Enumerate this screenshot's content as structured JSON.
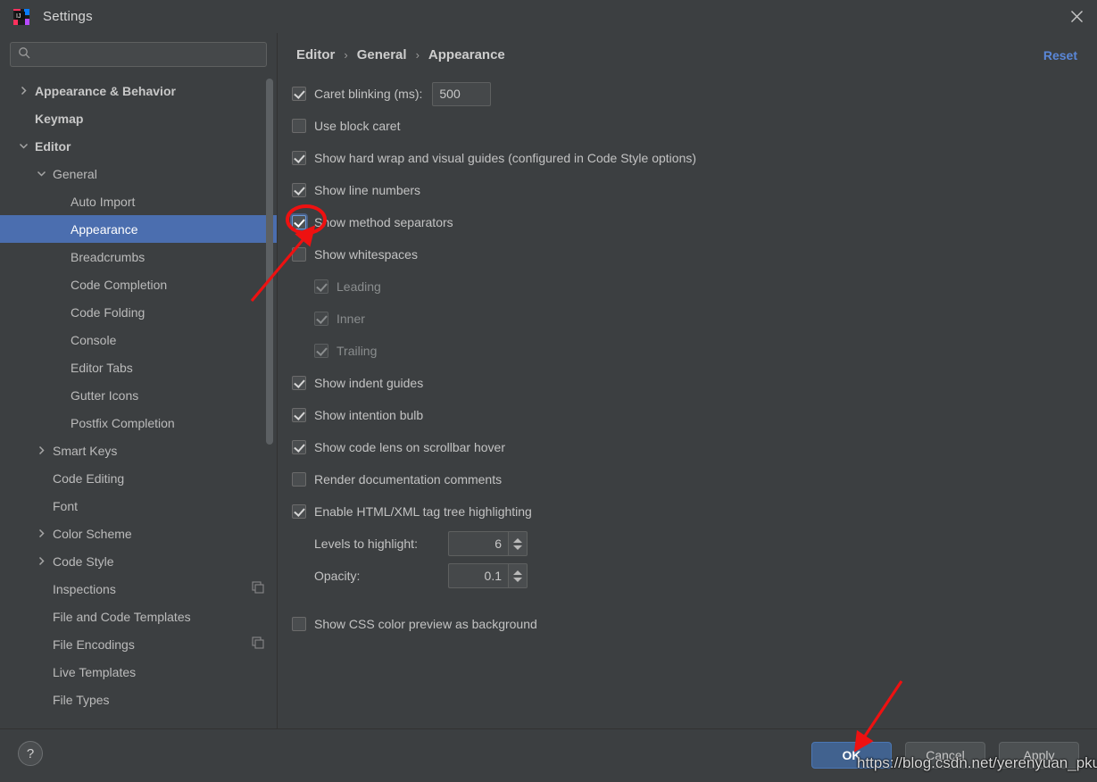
{
  "window": {
    "title": "Settings",
    "app_icon": "intellij-idea-icon",
    "close_icon": "close-icon"
  },
  "search": {
    "icon": "search-icon",
    "value": "",
    "placeholder": ""
  },
  "sidebar": {
    "scrollbar": "vertical-scrollbar",
    "items": [
      {
        "label": "Appearance & Behavior",
        "indent": 0,
        "twisty": "chevron-right-icon",
        "bold": true,
        "selected": false,
        "copy": false
      },
      {
        "label": "Keymap",
        "indent": 0,
        "twisty": "none",
        "bold": true,
        "selected": false,
        "copy": false
      },
      {
        "label": "Editor",
        "indent": 0,
        "twisty": "chevron-down-icon",
        "bold": true,
        "selected": false,
        "copy": false
      },
      {
        "label": "General",
        "indent": 1,
        "twisty": "chevron-down-icon",
        "bold": false,
        "selected": false,
        "copy": false
      },
      {
        "label": "Auto Import",
        "indent": 2,
        "twisty": "none",
        "bold": false,
        "selected": false,
        "copy": false
      },
      {
        "label": "Appearance",
        "indent": 2,
        "twisty": "none",
        "bold": false,
        "selected": true,
        "copy": false
      },
      {
        "label": "Breadcrumbs",
        "indent": 2,
        "twisty": "none",
        "bold": false,
        "selected": false,
        "copy": false
      },
      {
        "label": "Code Completion",
        "indent": 2,
        "twisty": "none",
        "bold": false,
        "selected": false,
        "copy": false
      },
      {
        "label": "Code Folding",
        "indent": 2,
        "twisty": "none",
        "bold": false,
        "selected": false,
        "copy": false
      },
      {
        "label": "Console",
        "indent": 2,
        "twisty": "none",
        "bold": false,
        "selected": false,
        "copy": false
      },
      {
        "label": "Editor Tabs",
        "indent": 2,
        "twisty": "none",
        "bold": false,
        "selected": false,
        "copy": false
      },
      {
        "label": "Gutter Icons",
        "indent": 2,
        "twisty": "none",
        "bold": false,
        "selected": false,
        "copy": false
      },
      {
        "label": "Postfix Completion",
        "indent": 2,
        "twisty": "none",
        "bold": false,
        "selected": false,
        "copy": false
      },
      {
        "label": "Smart Keys",
        "indent": 1,
        "twisty": "chevron-right-icon",
        "bold": false,
        "selected": false,
        "copy": false
      },
      {
        "label": "Code Editing",
        "indent": 1,
        "twisty": "none",
        "bold": false,
        "selected": false,
        "copy": false
      },
      {
        "label": "Font",
        "indent": 1,
        "twisty": "none",
        "bold": false,
        "selected": false,
        "copy": false
      },
      {
        "label": "Color Scheme",
        "indent": 1,
        "twisty": "chevron-right-icon",
        "bold": false,
        "selected": false,
        "copy": false
      },
      {
        "label": "Code Style",
        "indent": 1,
        "twisty": "chevron-right-icon",
        "bold": false,
        "selected": false,
        "copy": false
      },
      {
        "label": "Inspections",
        "indent": 1,
        "twisty": "none",
        "bold": false,
        "selected": false,
        "copy": true
      },
      {
        "label": "File and Code Templates",
        "indent": 1,
        "twisty": "none",
        "bold": false,
        "selected": false,
        "copy": false
      },
      {
        "label": "File Encodings",
        "indent": 1,
        "twisty": "none",
        "bold": false,
        "selected": false,
        "copy": true
      },
      {
        "label": "Live Templates",
        "indent": 1,
        "twisty": "none",
        "bold": false,
        "selected": false,
        "copy": false
      },
      {
        "label": "File Types",
        "indent": 1,
        "twisty": "none",
        "bold": false,
        "selected": false,
        "copy": false
      }
    ]
  },
  "breadcrumb": {
    "items": [
      "Editor",
      "General",
      "Appearance"
    ],
    "separator": "›"
  },
  "reset_label": "Reset",
  "options": [
    {
      "kind": "checkbox-with-field",
      "label": "Caret blinking (ms):",
      "checked": true,
      "enabled": true,
      "focused": false,
      "indent": 0,
      "field_value": "500"
    },
    {
      "kind": "checkbox",
      "label": "Use block caret",
      "checked": false,
      "enabled": true,
      "focused": false,
      "indent": 0
    },
    {
      "kind": "checkbox",
      "label": "Show hard wrap and visual guides (configured in Code Style options)",
      "checked": true,
      "enabled": true,
      "focused": false,
      "indent": 0
    },
    {
      "kind": "checkbox",
      "label": "Show line numbers",
      "checked": true,
      "enabled": true,
      "focused": false,
      "indent": 0
    },
    {
      "kind": "checkbox",
      "label": "Show method separators",
      "checked": true,
      "enabled": true,
      "focused": true,
      "indent": 0
    },
    {
      "kind": "checkbox",
      "label": "Show whitespaces",
      "checked": false,
      "enabled": true,
      "focused": false,
      "indent": 0
    },
    {
      "kind": "checkbox",
      "label": "Leading",
      "checked": true,
      "enabled": false,
      "focused": false,
      "indent": 1
    },
    {
      "kind": "checkbox",
      "label": "Inner",
      "checked": true,
      "enabled": false,
      "focused": false,
      "indent": 1
    },
    {
      "kind": "checkbox",
      "label": "Trailing",
      "checked": true,
      "enabled": false,
      "focused": false,
      "indent": 1
    },
    {
      "kind": "checkbox",
      "label": "Show indent guides",
      "checked": true,
      "enabled": true,
      "focused": false,
      "indent": 0
    },
    {
      "kind": "checkbox",
      "label": "Show intention bulb",
      "checked": true,
      "enabled": true,
      "focused": false,
      "indent": 0
    },
    {
      "kind": "checkbox",
      "label": "Show code lens on scrollbar hover",
      "checked": true,
      "enabled": true,
      "focused": false,
      "indent": 0
    },
    {
      "kind": "checkbox",
      "label": "Render documentation comments",
      "checked": false,
      "enabled": true,
      "focused": false,
      "indent": 0
    },
    {
      "kind": "checkbox",
      "label": "Enable HTML/XML tag tree highlighting",
      "checked": true,
      "enabled": true,
      "focused": false,
      "indent": 0
    },
    {
      "kind": "spinner",
      "label": "Levels to highlight:",
      "value": "6",
      "indent": 1
    },
    {
      "kind": "spinner",
      "label": "Opacity:",
      "value": "0.1",
      "indent": 1
    },
    {
      "kind": "spacer"
    },
    {
      "kind": "checkbox",
      "label": "Show CSS color preview as background",
      "checked": false,
      "enabled": true,
      "focused": false,
      "indent": 0
    }
  ],
  "footer": {
    "help_label": "?",
    "ok_label": "OK",
    "cancel_label": "Cancel",
    "apply_label": "Apply"
  },
  "annotations": {
    "watermark": "https://blog.csdn.net/yerenyuan_pku",
    "marker_color": "#ee1111",
    "highlight_ellipse": "red-ellipse-around-show-method-separators-checkbox",
    "arrow_to_checkbox": "red-arrow-pointing-to-show-method-separators",
    "arrow_to_ok": "red-arrow-pointing-to-ok-button"
  },
  "colors": {
    "background": "#3c3f41",
    "selection": "#4b6eaf",
    "accent_link": "#5a87d8",
    "primary_button": "#41628f"
  }
}
